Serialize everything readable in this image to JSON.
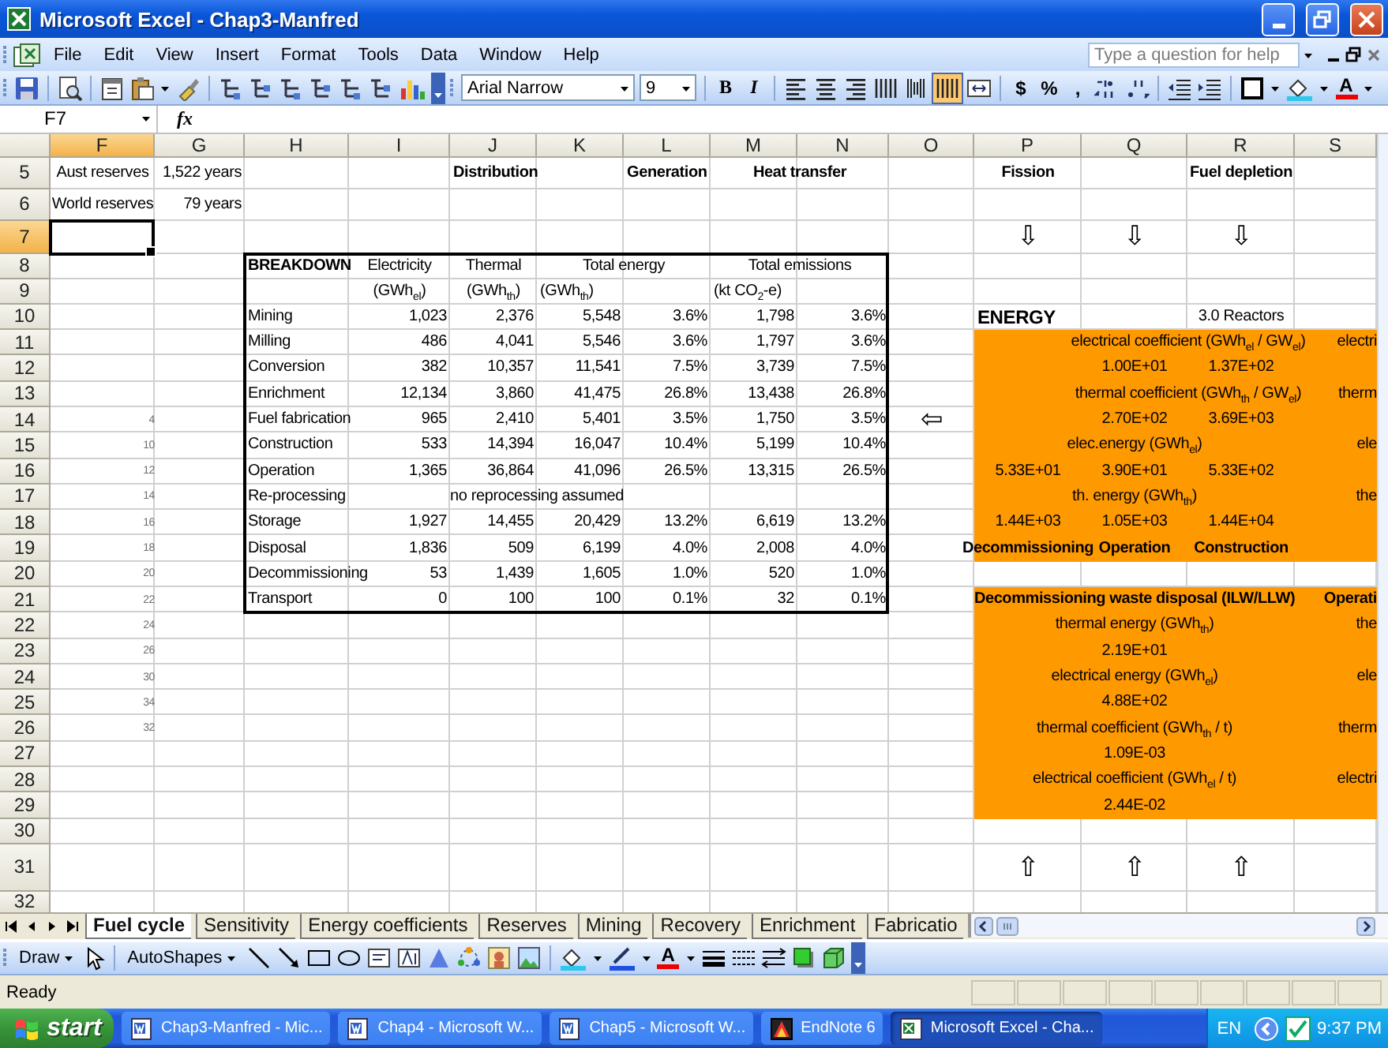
{
  "window": {
    "title": "Microsoft Excel - Chap3-Manfred"
  },
  "menu": [
    "File",
    "Edit",
    "View",
    "Insert",
    "Format",
    "Tools",
    "Data",
    "Window",
    "Help"
  ],
  "help_box": {
    "placeholder": "Type a question for help"
  },
  "toolbar": {
    "font": "Arial Narrow",
    "size": "9",
    "bold": "B",
    "italic": "I",
    "currency": "$",
    "percent": "%",
    "comma": ",",
    "font_color": "A",
    "merge_pressed": true
  },
  "formula_bar": {
    "name_box": "F7",
    "fx": "fx"
  },
  "columns": [
    {
      "label": "F",
      "selected": true
    },
    {
      "label": "G",
      "selected": false
    },
    {
      "label": "H",
      "selected": false
    },
    {
      "label": "I",
      "selected": false
    },
    {
      "label": "J",
      "selected": false
    },
    {
      "label": "K",
      "selected": false
    },
    {
      "label": "L",
      "selected": false
    },
    {
      "label": "M",
      "selected": false
    },
    {
      "label": "N",
      "selected": false
    },
    {
      "label": "O",
      "selected": false
    },
    {
      "label": "P",
      "selected": false
    },
    {
      "label": "Q",
      "selected": false
    },
    {
      "label": "R",
      "selected": false
    },
    {
      "label": "S",
      "selected": false
    }
  ],
  "rows": [
    {
      "number": "5",
      "selected": false,
      "F": {
        "text": "Aust reserves",
        "kind": "center"
      },
      "G": {
        "text": "1,522 years",
        "kind": "number"
      },
      "J": {
        "text": "Distribution",
        "kind": "heading"
      },
      "L": {
        "text": "Generation",
        "kind": "heading"
      },
      "M": {
        "text": "Heat transfer",
        "kind": "bold_across"
      },
      "P": {
        "text": "Fission",
        "kind": "bold_center"
      },
      "R": {
        "text": "Fuel depletion",
        "kind": "bold_center"
      }
    },
    {
      "number": "6",
      "selected": false,
      "F": {
        "text": "World reserves",
        "kind": "center"
      },
      "G": {
        "text": "79 years",
        "kind": "number"
      }
    },
    {
      "number": "7",
      "selected": true,
      "P": {
        "text": "⇩",
        "kind": "arrow"
      },
      "Q": {
        "text": "⇩",
        "kind": "arrow"
      },
      "R": {
        "text": "⇩",
        "kind": "arrow"
      }
    },
    {
      "number": "8",
      "selected": false,
      "boxed": true,
      "H": {
        "text": "BREAKDOWN",
        "kind": "heading"
      },
      "I": {
        "text": "Electricity",
        "kind": "center"
      },
      "J": {
        "text": "Thermal",
        "kind": "center"
      },
      "K": {
        "text": "Total energy",
        "kind": "center_across"
      },
      "M": {
        "text": "Total emissions",
        "kind": "center_across"
      }
    },
    {
      "number": "9",
      "selected": false,
      "boxed": true,
      "I": {
        "text": "(GWh$_{el}$)",
        "kind": "center"
      },
      "J": {
        "text": "(GWh$_{th}$)",
        "kind": "center"
      },
      "K": {
        "text": "(GWh$_{th}$)",
        "kind": "label"
      },
      "M": {
        "text": "(kt CO$_{2}$-e)",
        "kind": "label"
      }
    },
    {
      "number": "10",
      "selected": false,
      "boxed": true,
      "H": {
        "text": "Mining",
        "kind": "label"
      },
      "I": {
        "text": "1,023",
        "kind": "number"
      },
      "J": {
        "text": "2,376",
        "kind": "number"
      },
      "K": {
        "text": "5,548",
        "kind": "number"
      },
      "L": {
        "text": "3.6%",
        "kind": "number"
      },
      "M": {
        "text": "1,798",
        "kind": "number"
      },
      "N": {
        "text": "3.6%",
        "kind": "number"
      },
      "P": {
        "text": "ENERGY",
        "kind": "title"
      },
      "R": {
        "text": "3.0 Reactors",
        "kind": "center"
      }
    },
    {
      "number": "11",
      "selected": false,
      "boxed": true,
      "shaded": true,
      "H": {
        "text": "Milling",
        "kind": "label"
      },
      "I": {
        "text": "486",
        "kind": "number"
      },
      "J": {
        "text": "4,041",
        "kind": "number"
      },
      "K": {
        "text": "5,546",
        "kind": "number"
      },
      "L": {
        "text": "3.6%",
        "kind": "number"
      },
      "M": {
        "text": "1,797",
        "kind": "number"
      },
      "N": {
        "text": "3.6%",
        "kind": "number"
      },
      "Q": {
        "text": "electrical coefficient (GWh$_{el}$ / GW$_{el}$)",
        "kind": "center_across"
      },
      "S": {
        "text": "electri",
        "kind": "clipped"
      }
    },
    {
      "number": "12",
      "selected": false,
      "boxed": true,
      "shaded": true,
      "H": {
        "text": "Conversion",
        "kind": "label"
      },
      "I": {
        "text": "382",
        "kind": "number"
      },
      "J": {
        "text": "10,357",
        "kind": "number"
      },
      "K": {
        "text": "11,541",
        "kind": "number"
      },
      "L": {
        "text": "7.5%",
        "kind": "number"
      },
      "M": {
        "text": "3,739",
        "kind": "number"
      },
      "N": {
        "text": "7.5%",
        "kind": "number"
      },
      "Q": {
        "text": "1.00E+01",
        "kind": "center"
      },
      "R": {
        "text": "1.37E+02",
        "kind": "center"
      }
    },
    {
      "number": "13",
      "selected": false,
      "boxed": true,
      "shaded": true,
      "H": {
        "text": "Enrichment",
        "kind": "label"
      },
      "I": {
        "text": "12,134",
        "kind": "number"
      },
      "J": {
        "text": "3,860",
        "kind": "number"
      },
      "K": {
        "text": "41,475",
        "kind": "number"
      },
      "L": {
        "text": "26.8%",
        "kind": "number"
      },
      "M": {
        "text": "13,438",
        "kind": "number"
      },
      "N": {
        "text": "26.8%",
        "kind": "number"
      },
      "Q": {
        "text": "thermal coefficient (GWh$_{th}$ / GW$_{el}$)",
        "kind": "center_across"
      },
      "S": {
        "text": "therm",
        "kind": "clipped"
      }
    },
    {
      "number": "14",
      "selected": false,
      "boxed": true,
      "shaded": true,
      "F": {
        "text": "4",
        "kind": "note"
      },
      "H": {
        "text": "Fuel fabrication",
        "kind": "label"
      },
      "I": {
        "text": "965",
        "kind": "number"
      },
      "J": {
        "text": "2,410",
        "kind": "number"
      },
      "K": {
        "text": "5,401",
        "kind": "number"
      },
      "L": {
        "text": "3.5%",
        "kind": "number"
      },
      "M": {
        "text": "1,750",
        "kind": "number"
      },
      "N": {
        "text": "3.5%",
        "kind": "number"
      },
      "O": {
        "text": "⇦",
        "kind": "arrow"
      },
      "Q": {
        "text": "2.70E+02",
        "kind": "center"
      },
      "R": {
        "text": "3.69E+03",
        "kind": "center"
      }
    },
    {
      "number": "15",
      "selected": false,
      "boxed": true,
      "shaded": true,
      "F": {
        "text": "10",
        "kind": "note"
      },
      "H": {
        "text": "Construction",
        "kind": "label"
      },
      "I": {
        "text": "533",
        "kind": "number"
      },
      "J": {
        "text": "14,394",
        "kind": "number"
      },
      "K": {
        "text": "16,047",
        "kind": "number"
      },
      "L": {
        "text": "10.4%",
        "kind": "number"
      },
      "M": {
        "text": "5,199",
        "kind": "number"
      },
      "N": {
        "text": "10.4%",
        "kind": "number"
      },
      "Q": {
        "text": "elec.energy (GWh$_{el}$)",
        "kind": "center"
      },
      "S": {
        "text": "ele",
        "kind": "clipped"
      }
    },
    {
      "number": "16",
      "selected": false,
      "boxed": true,
      "shaded": true,
      "F": {
        "text": "12",
        "kind": "note"
      },
      "H": {
        "text": "Operation",
        "kind": "label"
      },
      "I": {
        "text": "1,365",
        "kind": "number"
      },
      "J": {
        "text": "36,864",
        "kind": "number"
      },
      "K": {
        "text": "41,096",
        "kind": "number"
      },
      "L": {
        "text": "26.5%",
        "kind": "number"
      },
      "M": {
        "text": "13,315",
        "kind": "number"
      },
      "N": {
        "text": "26.5%",
        "kind": "number"
      },
      "P": {
        "text": "5.33E+01",
        "kind": "center"
      },
      "Q": {
        "text": "3.90E+01",
        "kind": "center"
      },
      "R": {
        "text": "5.33E+02",
        "kind": "center"
      }
    },
    {
      "number": "17",
      "selected": false,
      "boxed": true,
      "shaded": true,
      "F": {
        "text": "14",
        "kind": "note"
      },
      "H": {
        "text": "Re-processing",
        "kind": "label"
      },
      "J": {
        "text": "no reprocessing assumed",
        "kind": "center_across"
      },
      "Q": {
        "text": "th. energy (GWh$_{th}$)",
        "kind": "center"
      },
      "S": {
        "text": "the",
        "kind": "clipped"
      }
    },
    {
      "number": "18",
      "selected": false,
      "boxed": true,
      "shaded": true,
      "F": {
        "text": "16",
        "kind": "note"
      },
      "H": {
        "text": "Storage",
        "kind": "label"
      },
      "I": {
        "text": "1,927",
        "kind": "number"
      },
      "J": {
        "text": "14,455",
        "kind": "number"
      },
      "K": {
        "text": "20,429",
        "kind": "number"
      },
      "L": {
        "text": "13.2%",
        "kind": "number"
      },
      "M": {
        "text": "6,619",
        "kind": "number"
      },
      "N": {
        "text": "13.2%",
        "kind": "number"
      },
      "P": {
        "text": "1.44E+03",
        "kind": "center"
      },
      "Q": {
        "text": "1.05E+03",
        "kind": "center"
      },
      "R": {
        "text": "1.44E+04",
        "kind": "center"
      }
    },
    {
      "number": "19",
      "selected": false,
      "boxed": true,
      "shaded": true,
      "F": {
        "text": "18",
        "kind": "note"
      },
      "H": {
        "text": "Disposal",
        "kind": "label"
      },
      "I": {
        "text": "1,836",
        "kind": "number"
      },
      "J": {
        "text": "509",
        "kind": "number"
      },
      "K": {
        "text": "6,199",
        "kind": "number"
      },
      "L": {
        "text": "4.0%",
        "kind": "number"
      },
      "M": {
        "text": "2,008",
        "kind": "number"
      },
      "N": {
        "text": "4.0%",
        "kind": "number"
      },
      "P": {
        "text": "Decommissioning",
        "kind": "bold_center"
      },
      "Q": {
        "text": "Operation",
        "kind": "bold_center"
      },
      "R": {
        "text": "Construction",
        "kind": "bold_center"
      }
    },
    {
      "number": "20",
      "selected": false,
      "boxed": true,
      "F": {
        "text": "20",
        "kind": "note"
      },
      "H": {
        "text": "Decommissioning",
        "kind": "label"
      },
      "I": {
        "text": "53",
        "kind": "number"
      },
      "J": {
        "text": "1,439",
        "kind": "number"
      },
      "K": {
        "text": "1,605",
        "kind": "number"
      },
      "L": {
        "text": "1.0%",
        "kind": "number"
      },
      "M": {
        "text": "520",
        "kind": "number"
      },
      "N": {
        "text": "1.0%",
        "kind": "number"
      }
    },
    {
      "number": "21",
      "selected": false,
      "boxed": true,
      "shaded": true,
      "F": {
        "text": "22",
        "kind": "note"
      },
      "H": {
        "text": "Transport",
        "kind": "label"
      },
      "I": {
        "text": "0",
        "kind": "number"
      },
      "J": {
        "text": "100",
        "kind": "number"
      },
      "K": {
        "text": "100",
        "kind": "number"
      },
      "L": {
        "text": "0.1%",
        "kind": "number"
      },
      "M": {
        "text": "32",
        "kind": "number"
      },
      "N": {
        "text": "0.1%",
        "kind": "number"
      },
      "Q": {
        "text": "Decommissioning waste disposal (ILW/LLW)",
        "kind": "bold_center"
      },
      "S": {
        "text": "Operati",
        "kind": "clipped_bold"
      }
    },
    {
      "number": "22",
      "selected": false,
      "shaded": true,
      "F": {
        "text": "24",
        "kind": "note"
      },
      "Q": {
        "text": "thermal energy (GWh$_{th}$)",
        "kind": "center"
      },
      "S": {
        "text": "the",
        "kind": "clipped"
      }
    },
    {
      "number": "23",
      "selected": false,
      "shaded": true,
      "F": {
        "text": "26",
        "kind": "note"
      },
      "Q": {
        "text": "2.19E+01",
        "kind": "center"
      }
    },
    {
      "number": "24",
      "selected": false,
      "shaded": true,
      "F": {
        "text": "30",
        "kind": "note"
      },
      "Q": {
        "text": "electrical energy (GWh$_{el}$)",
        "kind": "center"
      },
      "S": {
        "text": "ele",
        "kind": "clipped"
      }
    },
    {
      "number": "25",
      "selected": false,
      "shaded": true,
      "F": {
        "text": "34",
        "kind": "note"
      },
      "Q": {
        "text": "4.88E+02",
        "kind": "center"
      }
    },
    {
      "number": "26",
      "selected": false,
      "shaded": true,
      "F": {
        "text": "32",
        "kind": "note"
      },
      "Q": {
        "text": "thermal coefficient (GWh$_{th}$ / t)",
        "kind": "center"
      },
      "S": {
        "text": "therm",
        "kind": "clipped"
      }
    },
    {
      "number": "27",
      "selected": false,
      "shaded": true,
      "Q": {
        "text": "1.09E-03",
        "kind": "center"
      }
    },
    {
      "number": "28",
      "selected": false,
      "shaded": true,
      "Q": {
        "text": "electrical coefficient (GWh$_{el}$ / t)",
        "kind": "center"
      },
      "S": {
        "text": "electri",
        "kind": "clipped"
      }
    },
    {
      "number": "29",
      "selected": false,
      "shaded": true,
      "Q": {
        "text": "2.44E-02",
        "kind": "center"
      }
    },
    {
      "number": "30",
      "selected": false
    },
    {
      "number": "31",
      "selected": false,
      "P": {
        "text": "⇧",
        "kind": "arrow"
      },
      "Q": {
        "text": "⇧",
        "kind": "arrow"
      },
      "R": {
        "text": "⇧",
        "kind": "arrow"
      }
    },
    {
      "number": "32",
      "selected": false
    }
  ],
  "sheet_tabs": [
    {
      "label": "Fuel cycle",
      "selected": true
    },
    {
      "label": "Sensitivity",
      "selected": false
    },
    {
      "label": "Energy coefficients",
      "selected": false
    },
    {
      "label": "Reserves",
      "selected": false
    },
    {
      "label": "Mining",
      "selected": false
    },
    {
      "label": "Recovery",
      "selected": false
    },
    {
      "label": "Enrichment",
      "selected": false
    },
    {
      "label": "Fabricatio",
      "selected": false
    }
  ],
  "draw_toolbar": {
    "draw": "Draw",
    "autoshapes": "AutoShapes",
    "font_color": "A"
  },
  "status_bar": {
    "text": "Ready"
  },
  "taskbar": {
    "start": "start",
    "tasks": [
      {
        "label": "Chap3-Manfred - Mic...",
        "kind": "word",
        "selected": false
      },
      {
        "label": "Chap4 - Microsoft W...",
        "kind": "word",
        "selected": false
      },
      {
        "label": "Chap5 - Microsoft W...",
        "kind": "word",
        "selected": false
      },
      {
        "label": "EndNote 6",
        "kind": "endnote",
        "selected": false
      },
      {
        "label": "Microsoft Excel - Cha...",
        "kind": "excel",
        "selected": true
      }
    ],
    "language": "EN",
    "clock": "9:37 PM"
  }
}
